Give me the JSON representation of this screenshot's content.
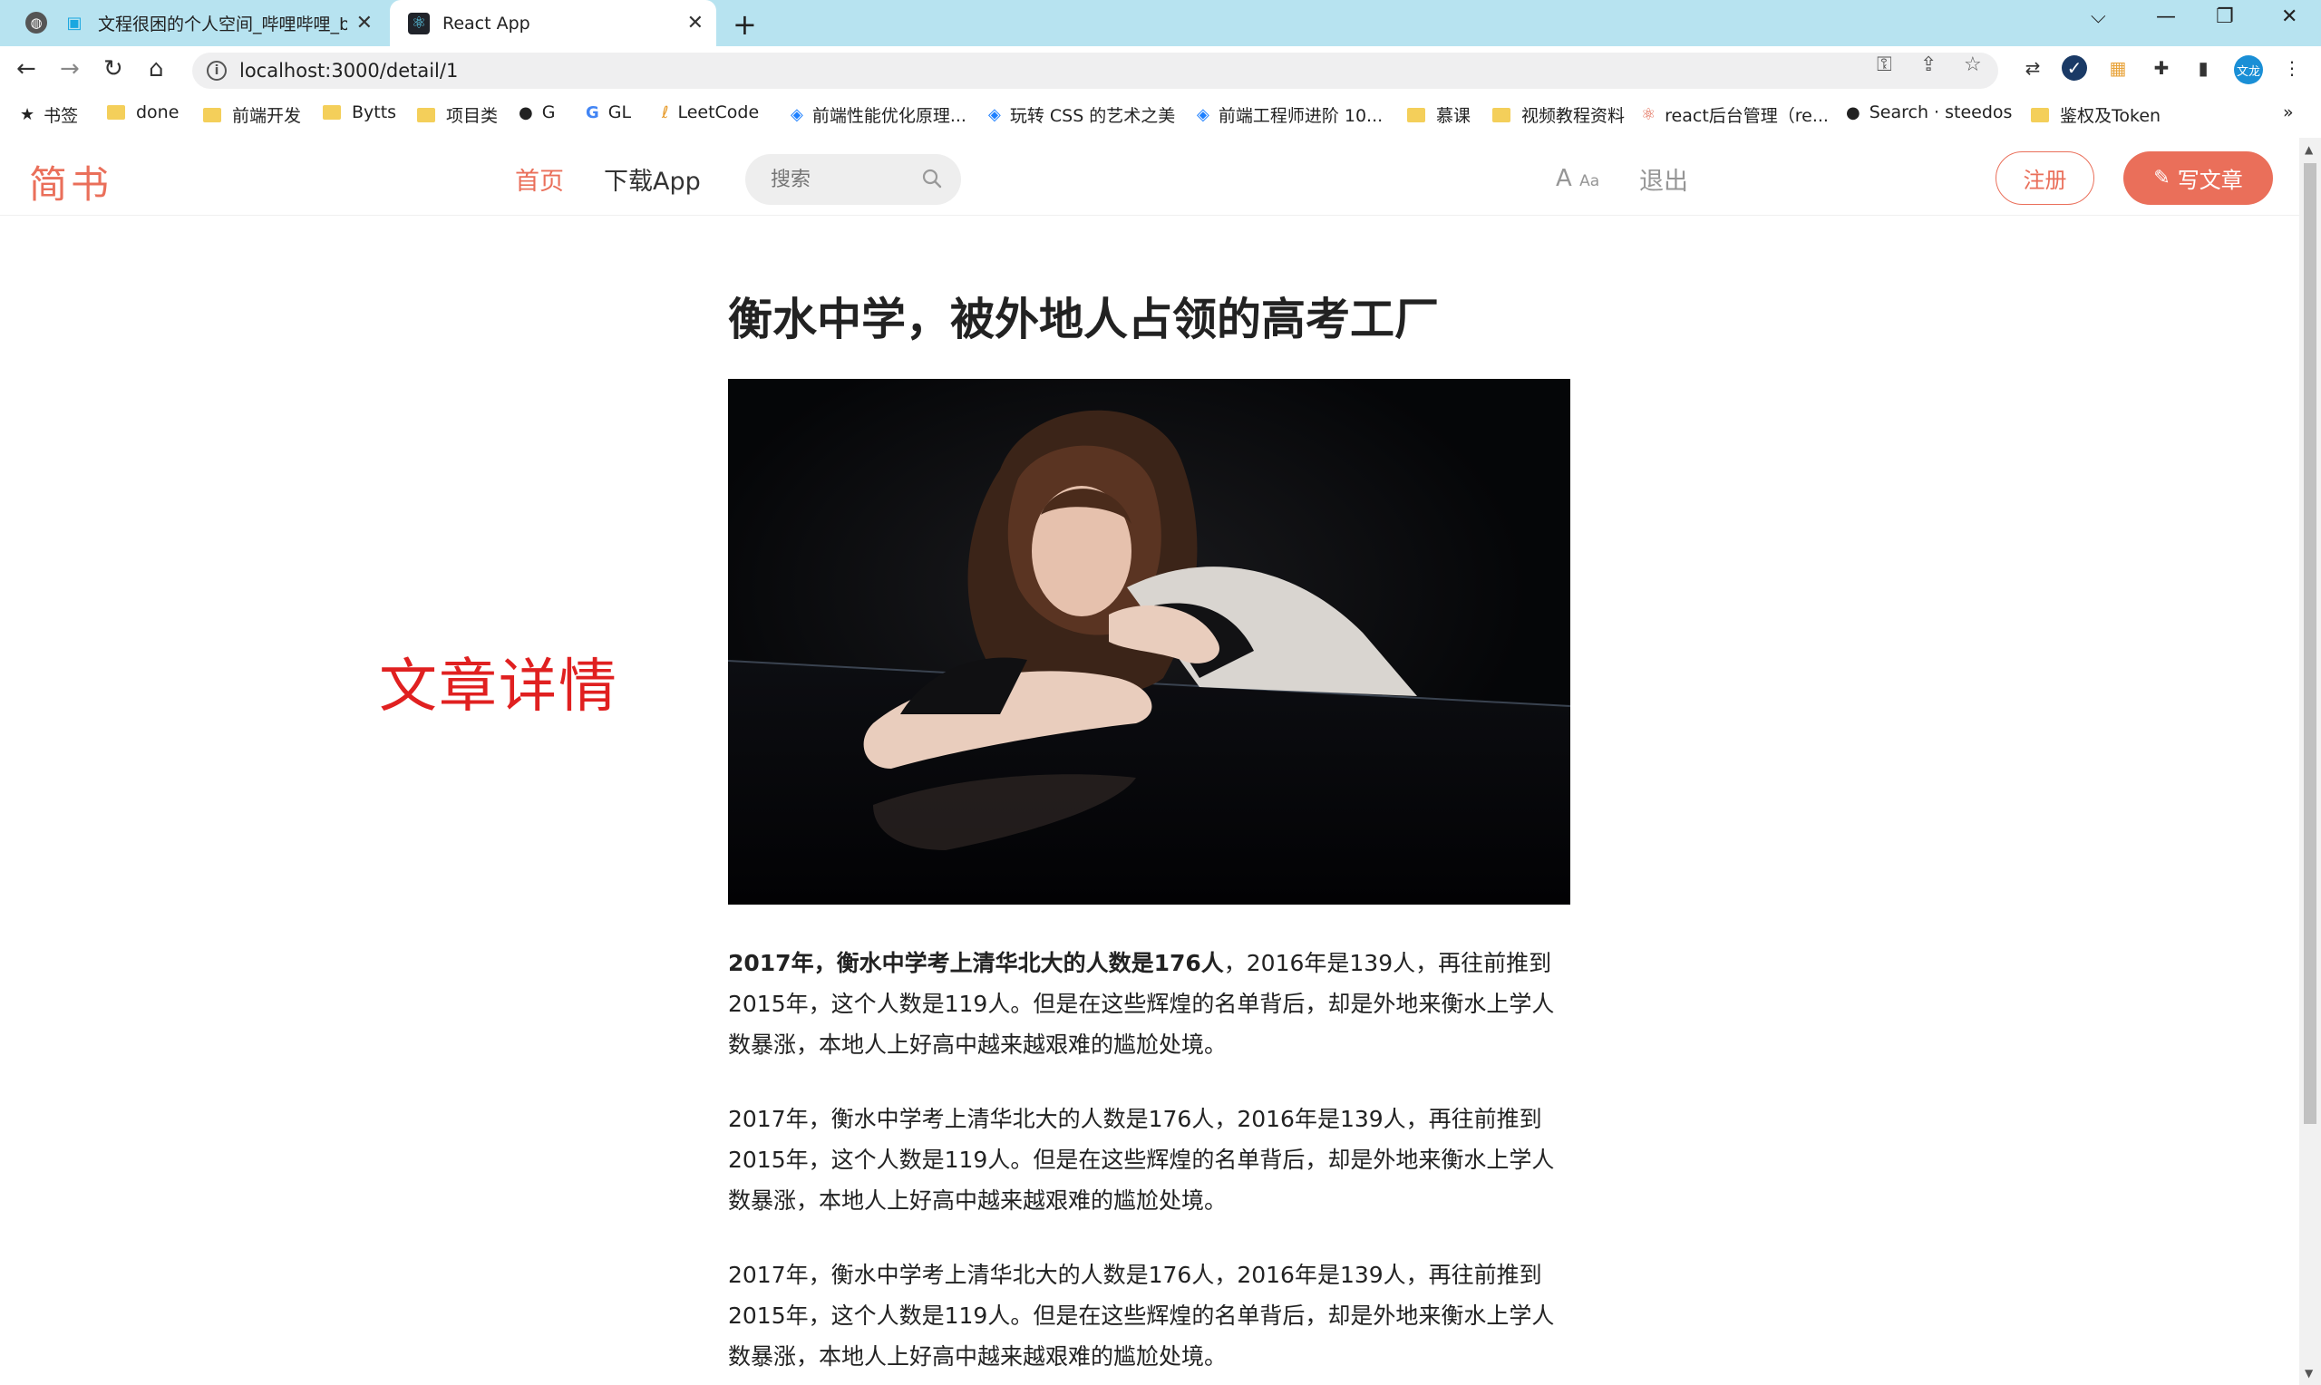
{
  "browser": {
    "tabs": [
      {
        "title": "文程很困的个人空间_哔哩哔哩_b",
        "active": false
      },
      {
        "title": "React App",
        "active": true
      }
    ],
    "url": "localhost:3000/detail/1",
    "bookmarks": [
      {
        "label": "书签",
        "icon": "star-icon"
      },
      {
        "label": "done",
        "icon": "folder-icon"
      },
      {
        "label": "前端开发",
        "icon": "folder-icon"
      },
      {
        "label": "Bytts",
        "icon": "folder-icon"
      },
      {
        "label": "项目类",
        "icon": "folder-icon"
      },
      {
        "label": "G",
        "icon": "github-icon"
      },
      {
        "label": "GL",
        "icon": "google-icon"
      },
      {
        "label": "LeetCode",
        "icon": "leetcode-icon"
      },
      {
        "label": "前端性能优化原理...",
        "icon": "juejin-icon"
      },
      {
        "label": "玩转 CSS 的艺术之美",
        "icon": "juejin-icon"
      },
      {
        "label": "前端工程师进阶 10...",
        "icon": "juejin-icon"
      },
      {
        "label": "慕课",
        "icon": "folder-icon"
      },
      {
        "label": "视频教程资料",
        "icon": "folder-icon"
      },
      {
        "label": "react后台管理（re...",
        "icon": "react-icon"
      },
      {
        "label": "Search · steedos",
        "icon": "github-icon"
      },
      {
        "label": "鉴权及Token",
        "icon": "folder-icon"
      }
    ],
    "profile_initials": "文龙"
  },
  "site": {
    "logo": "简书",
    "nav": {
      "home": "首页",
      "download": "下载App"
    },
    "search_placeholder": "搜索",
    "font_icon_big": "A",
    "font_icon_small": "Aa",
    "logout": "退出",
    "register": "注册",
    "write": "写文章",
    "accent_color": "#ea6f5a"
  },
  "side_label": "文章详情",
  "article": {
    "title": "衡水中学，被外地人占领的高考工厂",
    "paragraphs": [
      {
        "bold": "2017年，衡水中学考上清华北大的人数是176人",
        "text": "，2016年是139人，再往前推到2015年，这个人数是119人。但是在这些辉煌的名单背后，却是外地来衡水上学人数暴涨，本地人上好高中越来越艰难的尴尬处境。"
      },
      {
        "bold": "",
        "text": "2017年，衡水中学考上清华北大的人数是176人，2016年是139人，再往前推到2015年，这个人数是119人。但是在这些辉煌的名单背后，却是外地来衡水上学人数暴涨，本地人上好高中越来越艰难的尴尬处境。"
      },
      {
        "bold": "",
        "text": "2017年，衡水中学考上清华北大的人数是176人，2016年是139人，再往前推到2015年，这个人数是119人。但是在这些辉煌的名单背后，却是外地来衡水上学人数暴涨，本地人上好高中越来越艰难的尴尬处境。"
      }
    ]
  }
}
